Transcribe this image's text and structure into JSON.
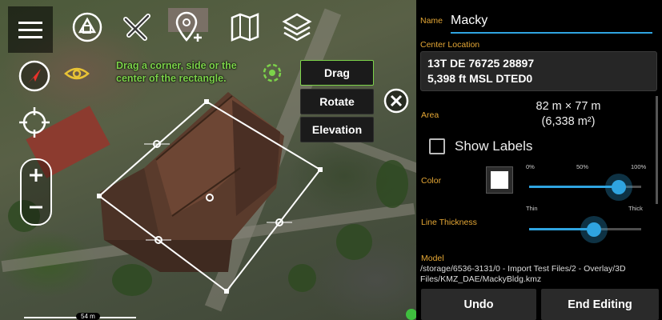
{
  "map": {
    "instruction": "Drag a corner, side or the center of the rectangle.",
    "modes": [
      "Drag",
      "Rotate",
      "Elevation"
    ],
    "active_mode": "Drag",
    "scale_label": "54 m",
    "toolbar_icons": [
      "shapes-icon",
      "x-tools-icon",
      "add-point-icon",
      "map-icon",
      "layers-icon"
    ]
  },
  "panel": {
    "name_label": "Name",
    "name_value": "Macky",
    "center_label": "Center Location",
    "mgrs": "13T DE 76725 28897",
    "elevation": "5,398 ft MSL DTED0",
    "area_label": "Area",
    "area_dims": "82 m × 77 m",
    "area_sq": "(6,338 m²)",
    "show_labels": "Show Labels",
    "show_labels_checked": false,
    "color_label": "Color",
    "color_value": "#ffffff",
    "opacity_ticks": [
      "0%",
      "50%",
      "100%"
    ],
    "opacity_value": 0.8,
    "line_thickness_label": "Line Thickness",
    "thickness_ticks": [
      "Thin",
      "Thick"
    ],
    "thickness_value": 0.58,
    "model_label": "Model",
    "model_path": "/storage/6536-3131/0 - Import Test Files/2 - Overlay/3D Files/KMZ_DAE/MackyBldg.kmz",
    "undo": "Undo",
    "end_editing": "End Editing"
  },
  "colors": {
    "accent": "#2fa4e0",
    "label": "#e5a735",
    "instruction": "#7cd34a"
  }
}
